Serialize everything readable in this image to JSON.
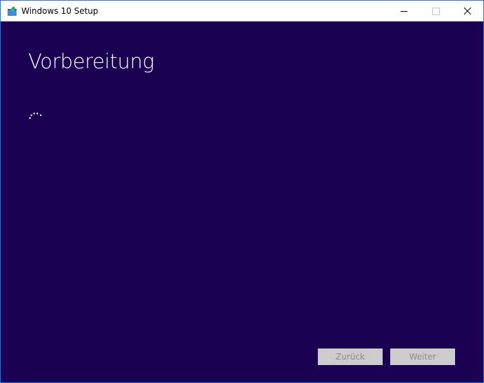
{
  "window": {
    "title": "Windows 10 Setup"
  },
  "main": {
    "heading": "Vorbereitung"
  },
  "footer": {
    "back_label": "Zurück",
    "next_label": "Weiter"
  },
  "icons": {
    "app": "windows-setup-icon",
    "minimize": "minimize-icon",
    "maximize": "maximize-icon",
    "close": "close-icon",
    "loading": "loading-spinner-icon"
  },
  "colors": {
    "background": "#1a0152",
    "titlebar": "#ffffff",
    "window_border": "#2b6fd6",
    "button_disabled_bg": "#cccccc",
    "button_disabled_text": "#8c8c8c",
    "heading_text": "#ffffff"
  }
}
